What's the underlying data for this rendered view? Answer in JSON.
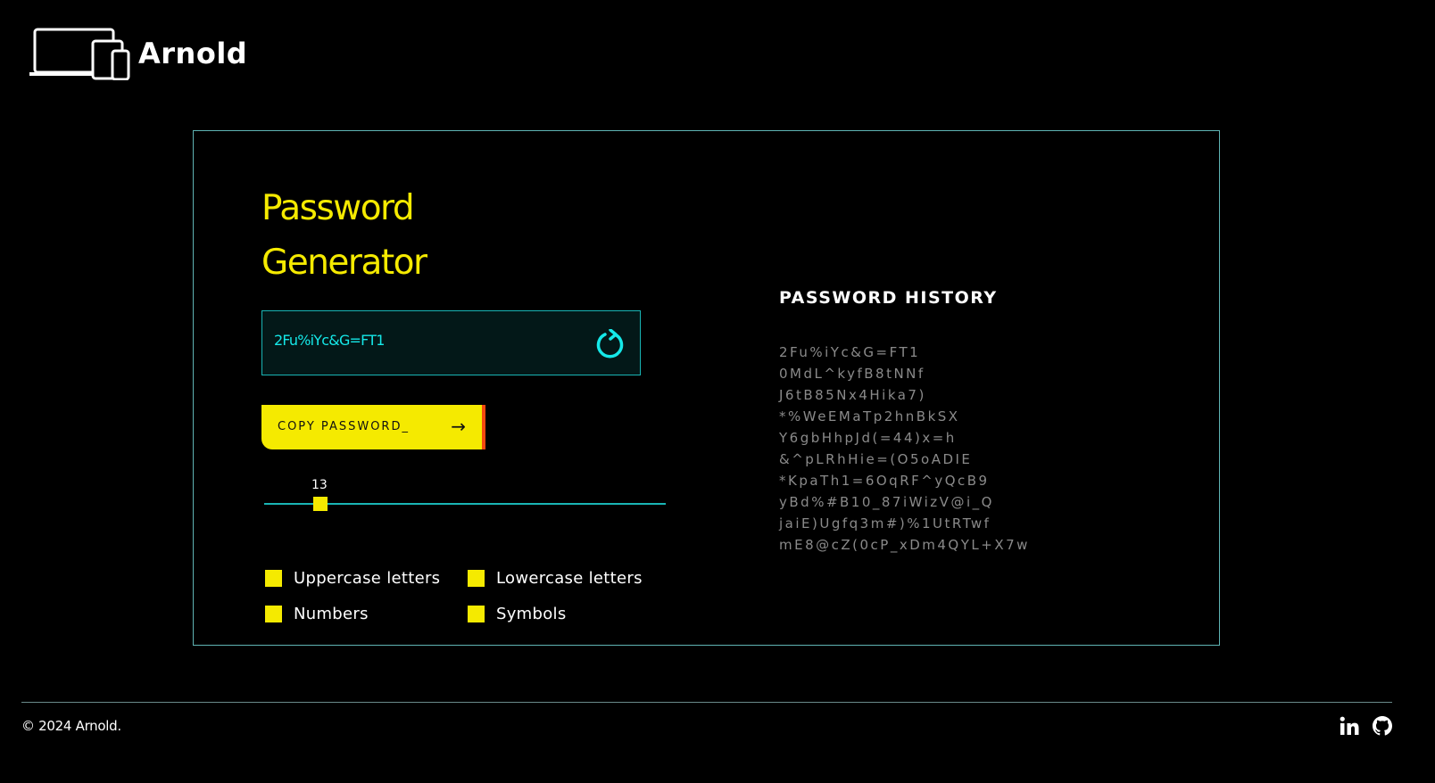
{
  "brand": {
    "name": "Arnold"
  },
  "generator": {
    "title_line1": "Password",
    "title_line2": "Generator",
    "password": "2Fu%iYc&G=FT1",
    "copy_label": "COPY PASSWORD_",
    "copy_arrow": "→",
    "length": 13,
    "length_fraction": 0.14,
    "options": [
      {
        "label": "Uppercase letters",
        "checked": true
      },
      {
        "label": "Lowercase letters",
        "checked": true
      },
      {
        "label": "Numbers",
        "checked": true
      },
      {
        "label": "Symbols",
        "checked": true
      }
    ]
  },
  "history": {
    "title": "PASSWORD HISTORY",
    "items": [
      "2Fu%iYc&G=FT1",
      "0MdL^kyfB8tNNf",
      "J6tB85Nx4Hika7)",
      "*%WeEMaTp2hnBkSX",
      "Y6gbHhpJd(=44)x=h",
      "&^pLRhHie=(O5oADIE",
      "*KpaTh1=6OqRF^yQcB9",
      "yBd%#B10_87iWizV@i_Q",
      "jaiE)Ugfq3m#)%1UtRTwf",
      "mE8@cZ(0cP_xDm4QYL+X7w"
    ]
  },
  "footer": {
    "copyright": "© 2024 Arnold.",
    "social": [
      "linkedin-icon",
      "github-icon"
    ]
  },
  "colors": {
    "accent": "#f5ea00",
    "cyan": "#15e8e8",
    "border": "#5fb3b3",
    "background": "#000000"
  }
}
